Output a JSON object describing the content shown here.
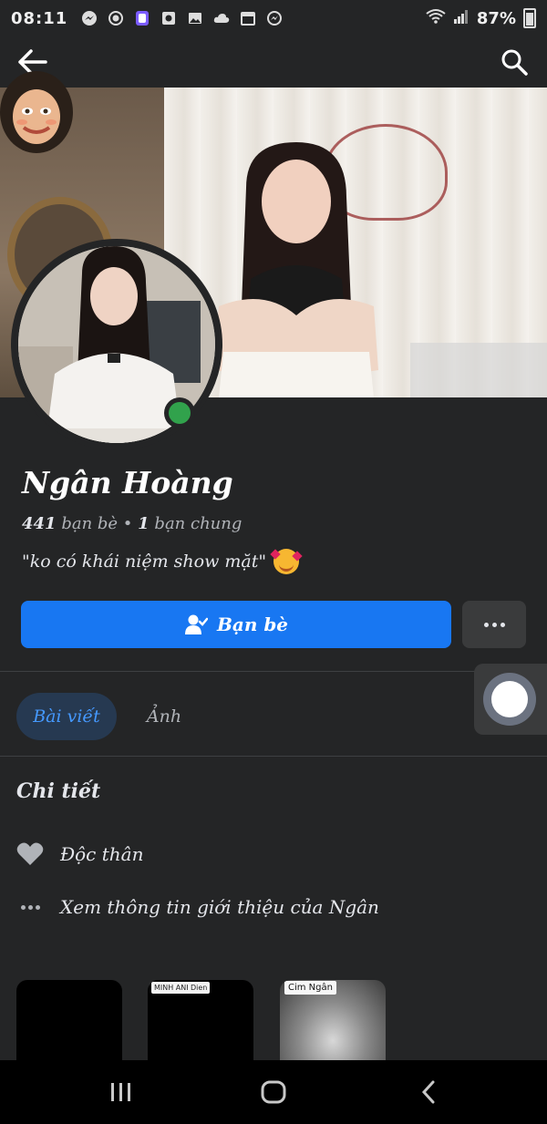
{
  "status_bar": {
    "time": "08:11",
    "battery": "87%",
    "icons": [
      "messenger-icon",
      "record-icon",
      "app-icon",
      "camera-icon",
      "gallery-icon",
      "cloud-icon",
      "calendar-icon",
      "messenger-icon"
    ]
  },
  "top_bar": {
    "back_icon": "arrow-left-icon",
    "search_icon": "search-icon"
  },
  "profile": {
    "name": "Ngân Hoàng",
    "friend_count": "441",
    "friends_label": "bạn bè",
    "separator": "•",
    "mutual_count": "1",
    "mutual_label": "bạn chung",
    "bio": "\"ko có khái niệm show mặt\"",
    "bio_emoji": "smiling-face-with-hearts-emoji",
    "online": true
  },
  "actions": {
    "friends_button": "Bạn bè",
    "more_button_icon": "more-horizontal-icon"
  },
  "tabs": [
    {
      "label": "Bài viết",
      "active": true
    },
    {
      "label": "Ảnh",
      "active": false
    }
  ],
  "details": {
    "title": "Chi tiết",
    "items": [
      {
        "icon": "heart-icon",
        "text": "Độc thân"
      },
      {
        "icon": "more-horizontal-icon",
        "text": "Xem thông tin giới thiệu của Ngân"
      }
    ]
  },
  "thumbnails": [
    {
      "tags": []
    },
    {
      "tags": [
        "MINH ANH",
        "Dien"
      ]
    },
    {
      "tags": [
        "Cim Ngân"
      ]
    }
  ],
  "nav_bar": {
    "recent_icon": "recent-apps-icon",
    "home_icon": "home-icon",
    "back_icon": "back-chevron-icon"
  },
  "colors": {
    "background": "#242526",
    "primary": "#1877f2",
    "online": "#31a24c",
    "tab_active_bg": "#263951",
    "tab_active_text": "#4599ff"
  }
}
